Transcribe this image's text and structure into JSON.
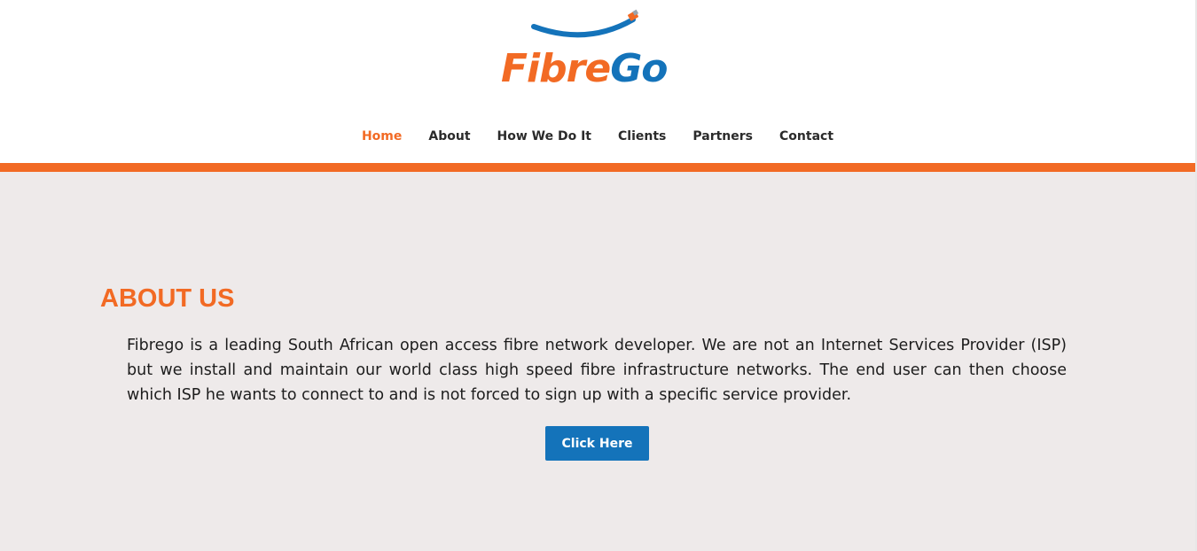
{
  "brand": {
    "logo_part1": "Fibre",
    "logo_part2": "Go",
    "orange": "#f26a24",
    "blue": "#1473ba"
  },
  "nav": {
    "items": [
      {
        "label": "Home",
        "active": true
      },
      {
        "label": "About",
        "active": false
      },
      {
        "label": "How We Do It",
        "active": false
      },
      {
        "label": "Clients",
        "active": false
      },
      {
        "label": "Partners",
        "active": false
      },
      {
        "label": "Contact",
        "active": false
      }
    ]
  },
  "about": {
    "title": "ABOUT US",
    "text": "Fibrego is a leading South African open access fibre network developer. We are not an Internet Services Provider (ISP) but we install and maintain our world class high speed fibre infrastructure networks. The end user can then choose which ISP he wants to connect to and is not forced to sign up with a specific service provider.",
    "button_label": "Click Here"
  },
  "colors": {
    "background_main": "#eeeaea",
    "accent_bar": "#f26a24"
  }
}
